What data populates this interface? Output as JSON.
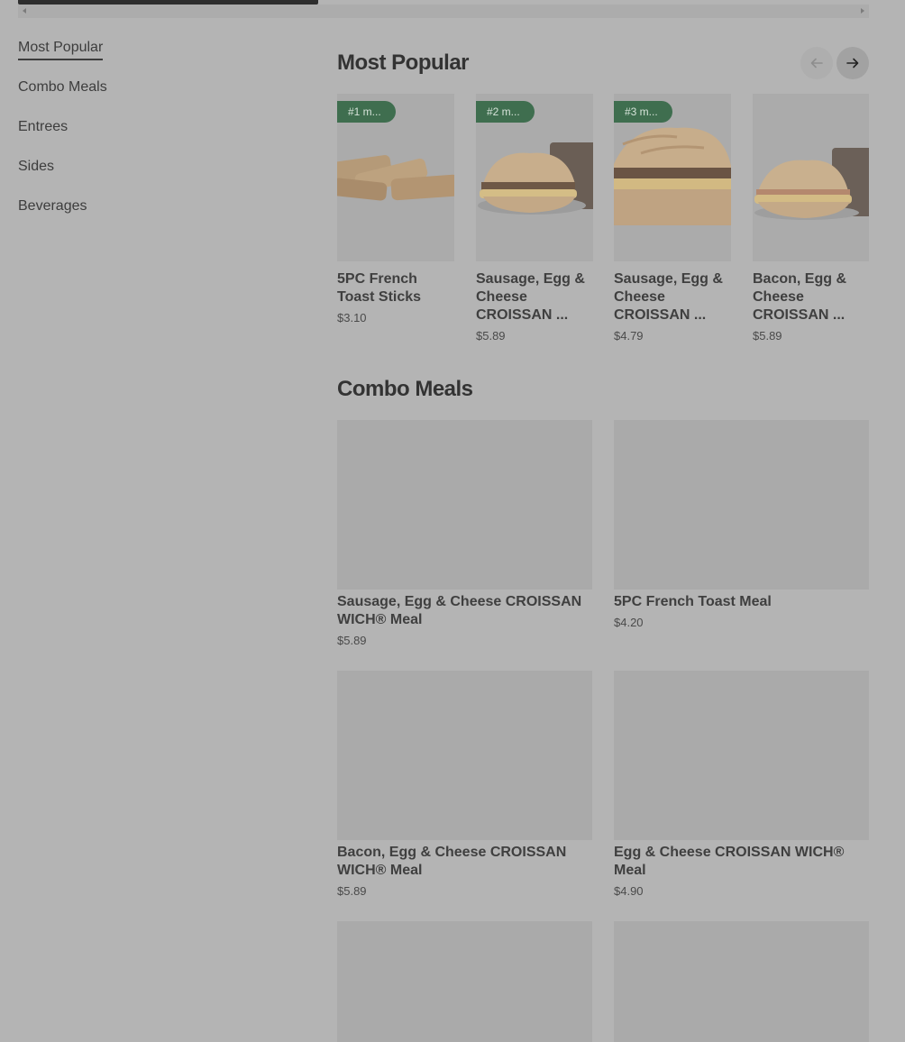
{
  "sidebar": {
    "items": [
      {
        "label": "Most Popular",
        "active": true
      },
      {
        "label": "Combo Meals"
      },
      {
        "label": "Entrees"
      },
      {
        "label": "Sides"
      },
      {
        "label": "Beverages"
      }
    ]
  },
  "popular": {
    "title": "Most Popular",
    "prev_icon": "arrow-left-icon",
    "next_icon": "arrow-right-icon",
    "items": [
      {
        "badge": "#1 m...",
        "name_line1": "5PC French",
        "name_line2": "Toast Sticks",
        "name_line3": "",
        "price": "$3.10"
      },
      {
        "badge": "#2 m...",
        "name_line1": "Sausage, Egg &",
        "name_line2": "Cheese",
        "name_line3": "CROISSAN ...",
        "price": "$5.89"
      },
      {
        "badge": "#3 m...",
        "name_line1": "Sausage, Egg &",
        "name_line2": "Cheese",
        "name_line3": "CROISSAN ...",
        "price": "$4.79"
      },
      {
        "badge": "",
        "name_line1": "Bacon, Egg &",
        "name_line2": "Cheese",
        "name_line3": "CROISSAN ...",
        "price": "$5.89"
      }
    ]
  },
  "combo": {
    "title": "Combo Meals",
    "items": [
      {
        "name_line1": "Sausage, Egg & Cheese CROISSAN",
        "name_line2": "WICH® Meal",
        "price": "$5.89"
      },
      {
        "name_line1": "5PC French Toast Meal",
        "name_line2": "",
        "price": "$4.20"
      },
      {
        "name_line1": "Bacon, Egg & Cheese CROISSAN",
        "name_line2": "WICH® Meal",
        "price": "$5.89"
      },
      {
        "name_line1": "Egg & Cheese CROISSAN WICH®",
        "name_line2": "Meal",
        "price": "$4.90"
      },
      {
        "name_line1": "",
        "name_line2": "",
        "price": ""
      },
      {
        "name_line1": "",
        "name_line2": "",
        "price": ""
      }
    ]
  },
  "colors": {
    "overlay_bg": "#b4b4b4",
    "badge_bg": "#3f6e4f",
    "text": "#3a3a3a"
  }
}
